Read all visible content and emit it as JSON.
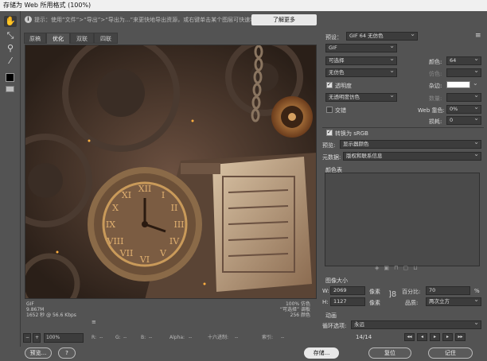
{
  "window": {
    "title": "存储为 Web 所用格式 (100%)"
  },
  "hint": {
    "icon": "i",
    "text": "提示：使用“文件”>“导出”>“导出为...”来更快地导出资源，或右键单击某个图层可快速将其导出为PNG",
    "learn_more": "了解更多"
  },
  "tabs": [
    "原稿",
    "优化",
    "双联",
    "四联"
  ],
  "active_tab": "优化",
  "image_info": {
    "format": "GIF",
    "size_kb": "9.867M",
    "time": "1652 秒 @ 56.6 Kbps",
    "menu_icon": "≡",
    "right_line1": "100% 仿色",
    "right_line2": "“可选择” 调板",
    "right_line3": "256 颜色"
  },
  "bottom_bar": {
    "zoom": "100%",
    "r_label": "R:",
    "r_value": "--",
    "g_label": "G:",
    "g_value": "--",
    "b_label": "B:",
    "b_value": "--",
    "alpha_label": "Alpha:",
    "alpha_value": "--",
    "hex_label": "十六进制:",
    "hex_value": "--",
    "index_label": "索引:",
    "index_value": "--"
  },
  "settings": {
    "preset_label": "预设：",
    "preset_value": "GIF 64 无仿色",
    "format": "GIF",
    "reduction": "可选择",
    "colors_label": "颜色:",
    "colors_value": "64",
    "dither_algo": "无仿色",
    "dither_label": "仿色:",
    "dither_value": "",
    "transparency_label": "透明度",
    "transparency_checked": true,
    "matte_label": "杂边:",
    "transparency_dither": "无透明度仿色",
    "amount_label": "数量:",
    "amount_value": "",
    "interlaced_label": "交错",
    "interlaced_checked": false,
    "web_snap_label": "Web 靠色:",
    "web_snap_value": "0%",
    "lossy_label": "损耗:",
    "lossy_value": "0",
    "convert_srgb_label": "转换为 sRGB",
    "convert_srgb_checked": true,
    "preview_label": "预览:",
    "preview_value": "显示器颜色",
    "metadata_label": "元数据:",
    "metadata_value": "版权和联系信息"
  },
  "color_table": {
    "title": "颜色表",
    "icons": [
      "shield-icon",
      "cube-icon",
      "lock-icon",
      "new-icon",
      "trash-icon"
    ]
  },
  "image_size": {
    "title": "图像大小",
    "w_label": "W:",
    "w_value": "2069",
    "w_unit": "像素",
    "h_label": "H:",
    "h_value": "1127",
    "h_unit": "像素",
    "percent_label": "百分比:",
    "percent_value": "70",
    "percent_unit": "%",
    "quality_label": "品质:",
    "quality_value": "两次立方"
  },
  "animation": {
    "title": "动画",
    "loop_label": "循环选项:",
    "loop_value": "永远",
    "frame_counter": "14/14"
  },
  "footer": {
    "preview_btn": "预览...",
    "help_icon": "?",
    "save_btn": "存储...",
    "reset_btn": "复位",
    "remember_btn": "记住"
  }
}
